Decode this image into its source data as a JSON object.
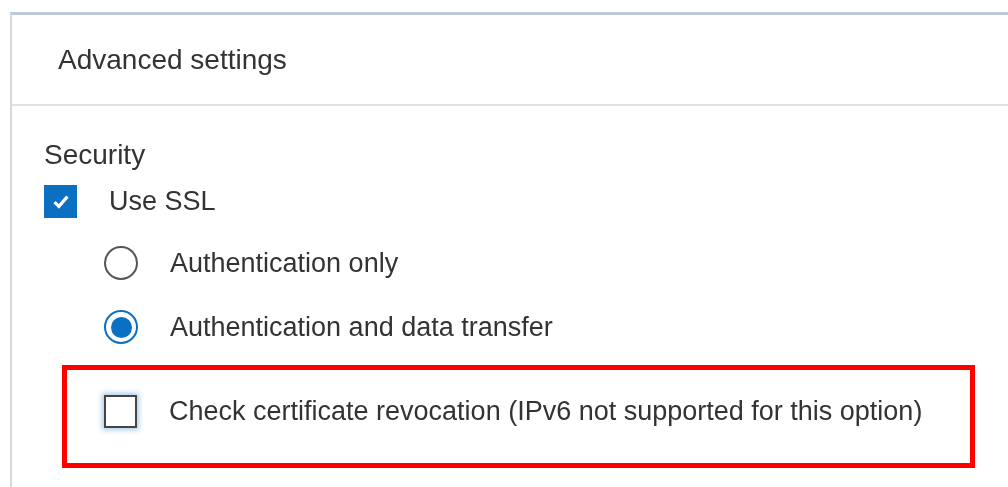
{
  "panel": {
    "title": "Advanced settings"
  },
  "section": {
    "title": "Security"
  },
  "options": [
    {
      "kind": "checkbox",
      "label": "Use SSL",
      "checked": true,
      "highlighted": false,
      "children": [
        {
          "kind": "radio",
          "label": "Authentication only",
          "selected": false,
          "highlighted": false
        },
        {
          "kind": "radio",
          "label": "Authentication and data transfer",
          "selected": true,
          "highlighted": false
        },
        {
          "kind": "checkbox",
          "label": "Check certificate revocation (IPv6 not supported for this option)",
          "checked": false,
          "highlighted": true
        }
      ]
    }
  ]
}
